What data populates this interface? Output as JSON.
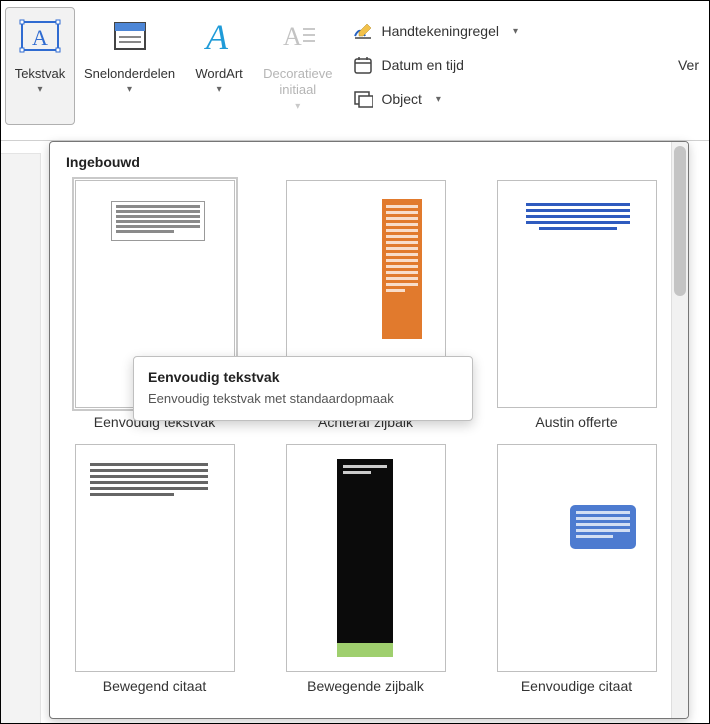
{
  "ribbon": {
    "tekstvak_label": "Tekstvak",
    "snelonderdelen_label": "Snelonderdelen",
    "wordart_label": "WordArt",
    "decoratieve_label": "Decoratieve\ninitiaal",
    "lines": {
      "handtekening": "Handtekeningregel",
      "datum": "Datum en tijd",
      "object": "Object"
    },
    "right_cut": "Ver"
  },
  "gallery": {
    "header": "Ingebouwd",
    "items": [
      {
        "label": "Eenvoudig tekstvak"
      },
      {
        "label": "Achteraf zijbalk"
      },
      {
        "label": "Austin offerte"
      },
      {
        "label": "Bewegend citaat"
      },
      {
        "label": "Bewegende zijbalk"
      },
      {
        "label": "Eenvoudige citaat"
      }
    ]
  },
  "tooltip": {
    "title": "Eenvoudig tekstvak",
    "desc": "Eenvoudig tekstvak met standaardopmaak"
  }
}
